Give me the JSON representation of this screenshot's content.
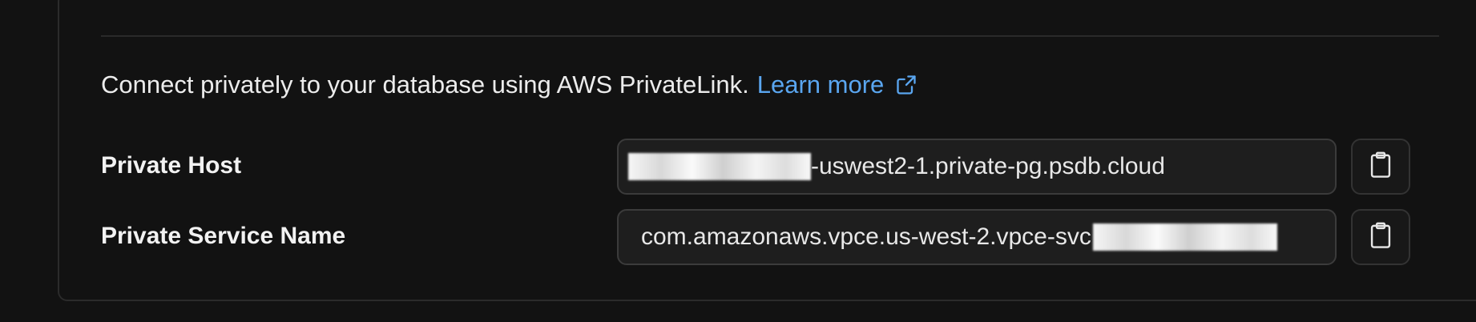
{
  "privatelink": {
    "description": "Connect privately to your database using AWS PrivateLink.",
    "learn_more_label": "Learn more",
    "icons": {
      "external_link": "external-link-icon",
      "copy": "clipboard-icon"
    },
    "accent_color": "#5aa6f0"
  },
  "private_host": {
    "label": "Private Host",
    "value_suffix": "-uswest2-1.private-pg.psdb.cloud"
  },
  "private_service_name": {
    "label": "Private Service Name",
    "value_prefix": "com.amazonaws.vpce.us-west-2.vpce-svc"
  }
}
